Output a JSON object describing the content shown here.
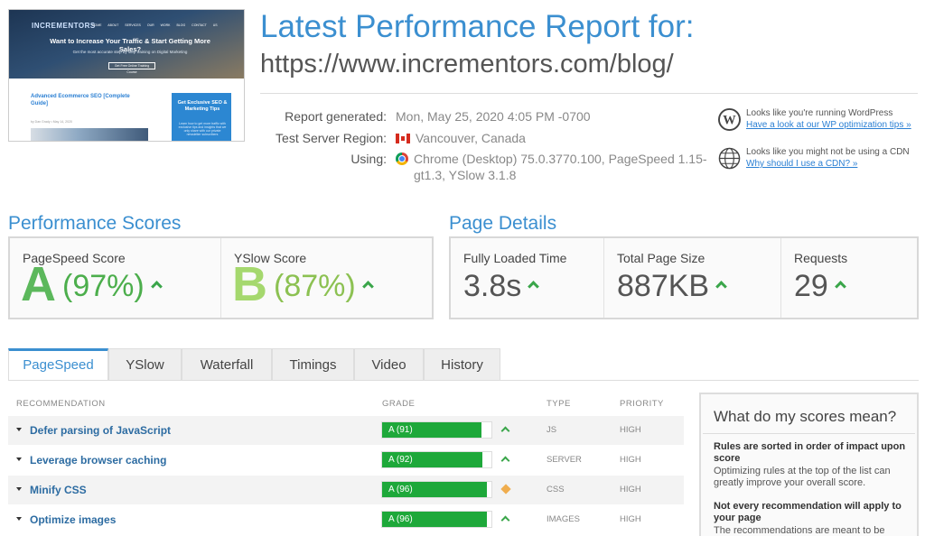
{
  "thumbnail": {
    "logo": "INCREMENTORS",
    "nav": "HOME  ABOUT  SERVICES  OUR WORK  BLOG  CONTACT US",
    "hero_title": "Want to Increase Your Traffic & Start Getting More Sales?",
    "hero_sub": "Get the most accurate step by step training on Digital Marketing",
    "hero_button": "Get Free Online Training Course",
    "article_title": "Advanced Ecommerce SEO [Complete Guide]",
    "article_meta": "by Dan Grady  •  May 14, 2020",
    "side_title": "Get Exclusive SEO & Marketing Tips",
    "side_sub": "Learn how to get more traffic with exclusive tips and insights that we only share with our private newsletter subscribers"
  },
  "header": {
    "title": "Latest Performance Report for:",
    "url": "https://www.incrementors.com/blog/"
  },
  "info": {
    "report_label": "Report generated:",
    "report_value": "Mon, May 25, 2020 4:05 PM -0700",
    "region_label": "Test Server Region:",
    "region_value": "Vancouver, Canada",
    "using_label": "Using:",
    "using_value_line1": "Chrome (Desktop) 75.0.3770.100, PageSpeed 1.15-",
    "using_value_line2": "gt1.3, YSlow 3.1.8"
  },
  "notices": [
    {
      "text": "Looks like you're running WordPress",
      "link": "Have a look at our WP optimization tips »"
    },
    {
      "text": "Looks like you might not be using a CDN",
      "link": "Why should I use a CDN? »"
    }
  ],
  "performance": {
    "title": "Performance Scores",
    "pagespeed": {
      "label": "PageSpeed Score",
      "grade": "A",
      "percent": "(97%)"
    },
    "yslow": {
      "label": "YSlow Score",
      "grade": "B",
      "percent": "(87%)"
    }
  },
  "details": {
    "title": "Page Details",
    "items": [
      {
        "label": "Fully Loaded Time",
        "value": "3.8s"
      },
      {
        "label": "Total Page Size",
        "value": "887KB"
      },
      {
        "label": "Requests",
        "value": "29"
      }
    ]
  },
  "tabs": [
    "PageSpeed",
    "YSlow",
    "Waterfall",
    "Timings",
    "Video",
    "History"
  ],
  "table": {
    "headers": {
      "recommendation": "RECOMMENDATION",
      "grade": "GRADE",
      "type": "TYPE",
      "priority": "PRIORITY"
    },
    "rows": [
      {
        "name": "Defer parsing of JavaScript",
        "grade": "A (91)",
        "score": 91,
        "trend": "up",
        "type": "JS",
        "priority": "HIGH"
      },
      {
        "name": "Leverage browser caching",
        "grade": "A (92)",
        "score": 92,
        "trend": "up",
        "type": "SERVER",
        "priority": "HIGH"
      },
      {
        "name": "Minify CSS",
        "grade": "A (96)",
        "score": 96,
        "trend": "same",
        "type": "CSS",
        "priority": "HIGH"
      },
      {
        "name": "Optimize images",
        "grade": "A (96)",
        "score": 96,
        "trend": "up",
        "type": "IMAGES",
        "priority": "HIGH"
      }
    ]
  },
  "scores_box": {
    "title": "What do my scores mean?",
    "b1": "Rules are sorted in order of impact upon score",
    "p1": "Optimizing rules at the top of the list can greatly improve your overall score.",
    "b2": "Not every recommendation will apply to your page",
    "p2": "The recommendations are meant to be"
  },
  "colors": {
    "accent": "#3b8fd0",
    "grade_green": "#1ea83a",
    "trend_up": "#3aa64a",
    "trend_same": "#f0ad4e"
  }
}
